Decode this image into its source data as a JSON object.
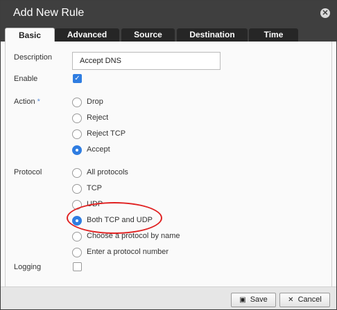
{
  "dialog": {
    "title": "Add New Rule",
    "close_glyph": "✕"
  },
  "tabs": [
    {
      "label": "Basic",
      "active": true
    },
    {
      "label": "Advanced",
      "active": false
    },
    {
      "label": "Source",
      "active": false
    },
    {
      "label": "Destination",
      "active": false
    },
    {
      "label": "Time",
      "active": false
    }
  ],
  "form": {
    "description": {
      "label": "Description",
      "value": "Accept DNS"
    },
    "enable": {
      "label": "Enable",
      "checked": true,
      "check_glyph": "✓"
    },
    "action": {
      "label": "Action",
      "required_marker": "*",
      "options": [
        {
          "label": "Drop",
          "selected": false
        },
        {
          "label": "Reject",
          "selected": false
        },
        {
          "label": "Reject TCP",
          "selected": false
        },
        {
          "label": "Accept",
          "selected": true
        }
      ]
    },
    "protocol": {
      "label": "Protocol",
      "options": [
        {
          "label": "All protocols",
          "selected": false
        },
        {
          "label": "TCP",
          "selected": false
        },
        {
          "label": "UDP",
          "selected": false
        },
        {
          "label": "Both TCP and UDP",
          "selected": true
        },
        {
          "label": "Choose a protocol by name",
          "selected": false
        },
        {
          "label": "Enter a protocol number",
          "selected": false
        }
      ]
    },
    "logging": {
      "label": "Logging",
      "checked": false
    }
  },
  "footer": {
    "save_label": "Save",
    "save_icon": "floppy-disk-icon",
    "save_glyph": "▣",
    "cancel_label": "Cancel",
    "cancel_icon": "x-icon",
    "cancel_glyph": "✕"
  },
  "colors": {
    "accent": "#2f7de1",
    "titlebar": "#3f3f3f",
    "annotation": "#e02020"
  }
}
